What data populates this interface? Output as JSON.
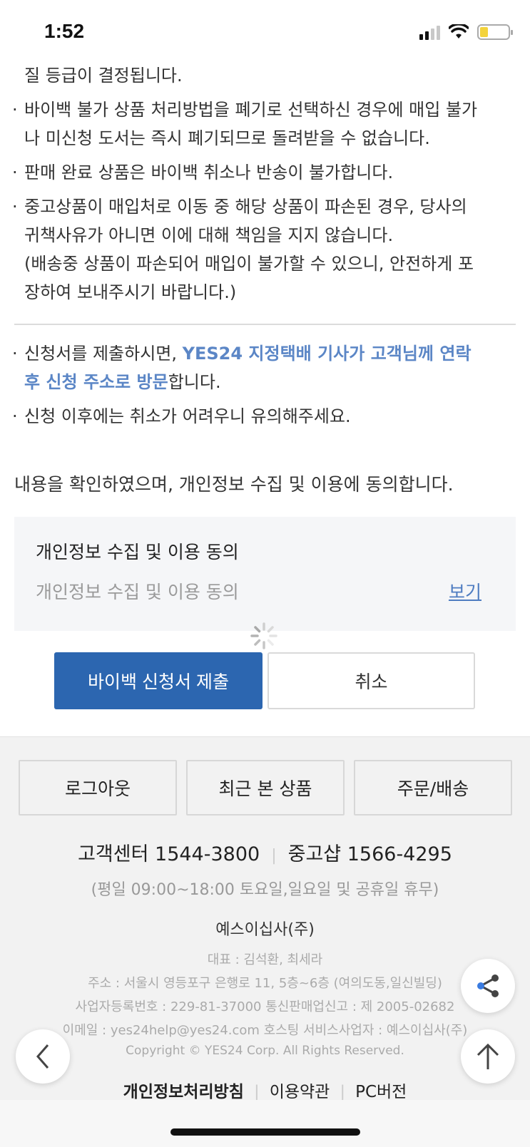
{
  "status_bar": {
    "time": "1:52",
    "battery_level": 0.3
  },
  "notice": {
    "lines": [
      {
        "text": "질 등급이 결정됩니다.",
        "bullet": false
      },
      {
        "text": "바이백 불가 상품 처리방법을 폐기로 선택하신 경우에 매입 불가",
        "bullet": true
      },
      {
        "text": "나 미신청 도서는 즉시 폐기되므로 돌려받을 수 없습니다.",
        "bullet": false
      },
      {
        "text": "판매 완료 상품은 바이백 취소나 반송이 불가합니다.",
        "bullet": true
      },
      {
        "text": "중고상품이 매입처로 이동 중 해당 상품이 파손된 경우, 당사의",
        "bullet": true
      },
      {
        "text": "귀책사유가 아니면 이에 대해 책임을 지지 않습니다.",
        "bullet": false
      },
      {
        "text": "(배송중 상품이 파손되어 매입이 불가할 수 있으니, 안전하게 포",
        "bullet": false
      },
      {
        "text": "장하여 보내주시기 바랍니다.)",
        "bullet": false
      }
    ]
  },
  "notice2": {
    "line1_prefix": "신청서를 제출하시면, ",
    "line1_highlight": "YES24 지정택배 기사가 고객님께 연락",
    "line2_highlight": "후 신청 주소로 방문",
    "line2_suffix": "합니다.",
    "line3": "신청 이후에는 취소가 어려우니 유의해주세요."
  },
  "agree_text": "내용을 확인하였으며, 개인정보 수집 및 이용에 동의합니다.",
  "privacy": {
    "title": "개인정보 수집 및 이용 동의",
    "subtitle": "개인정보 수집 및 이용 동의",
    "view_link": "보기"
  },
  "actions": {
    "submit": "바이백 신청서 제출",
    "cancel": "취소"
  },
  "footer": {
    "buttons": [
      "로그아웃",
      "최근 본 상품",
      "주문/배송"
    ],
    "customer_center": "고객센터 1544-3800",
    "used_shop": "중고샵 1566-4295",
    "hours": "(평일 09:00~18:00 토요일,일요일 및 공휴일 휴무)",
    "company": "예스이십사(주)",
    "ceo": "대표 : 김석환, 최세라",
    "address": "주소 : 서울시 영등포구 은행로 11, 5층~6층 (여의도동,일신빌딩)",
    "business_no": "사업자등록번호 : 229-81-37000   통신판매업신고 : 제 2005-02682",
    "email": "이메일 : yes24help@yes24.com   호스팅 서비스사업자 : 예스이십사(주)",
    "copyright": "Copyright © YES24 Corp. All Rights Reserved.",
    "links": [
      "개인정보처리방침",
      "이용약관",
      "PC버전"
    ]
  },
  "colors": {
    "accent": "#2c66b0",
    "link": "#5b86c6",
    "footer_bg": "#f2f2f2"
  }
}
